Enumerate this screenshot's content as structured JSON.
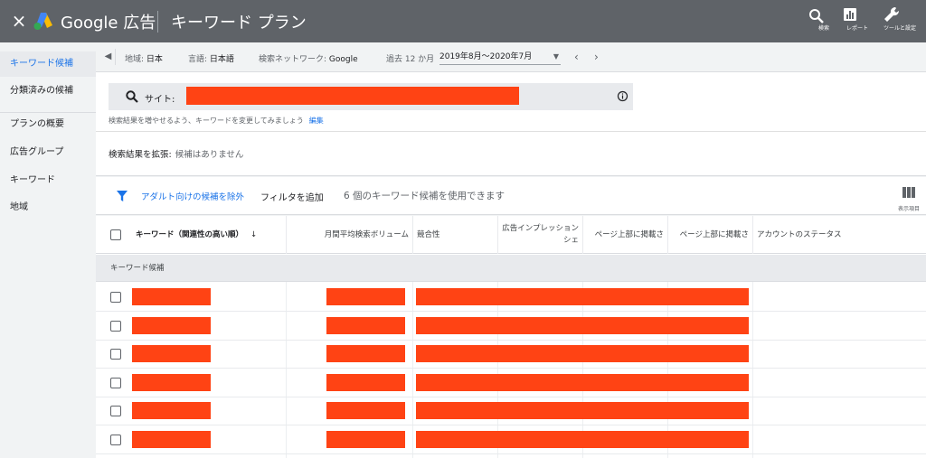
{
  "header": {
    "close_label": "×",
    "brand": "Google 広告",
    "title": "キーワード プラン",
    "tools": [
      {
        "icon": "search-icon",
        "label": "検索"
      },
      {
        "icon": "report-icon",
        "label": "レポート"
      },
      {
        "icon": "wrench-icon",
        "label": "ツールと設定"
      }
    ]
  },
  "sidebar": {
    "items": [
      {
        "label": "キーワード候補",
        "active": true
      },
      {
        "label": "分類済みの候補",
        "active": false
      },
      {
        "label": "プランの概要",
        "active": false
      },
      {
        "label": "広告グループ",
        "active": false
      },
      {
        "label": "キーワード",
        "active": false
      },
      {
        "label": "地域",
        "active": false
      }
    ]
  },
  "filterbar": {
    "location_label": "地域:",
    "location_value": "日本",
    "language_label": "言語:",
    "language_value": "日本語",
    "network_label": "検索ネットワーク:",
    "network_value": "Google",
    "period_label": "過去 12 か月",
    "date_range": "2019年8月〜2020年7月"
  },
  "search": {
    "prefix": "サイト:",
    "hint": "検索結果を増やせるよう、キーワードを変更してみましょう",
    "edit_link": "編集",
    "expand_label": "検索結果を拡張:",
    "expand_value": "候補はありません"
  },
  "toolbar": {
    "exclude_adult": "アダルト向けの候補を除外",
    "add_filter": "フィルタを追加",
    "count_text": "6 個のキーワード候補を使用できます",
    "columns_label": "表示項目"
  },
  "table": {
    "columns": [
      "キーワード（関連性の高い順）",
      "月間平均検索ボリューム",
      "競合性",
      "広告インプレッション シェ",
      "ページ上部に掲載さ",
      "ページ上部に掲載さ",
      "アカウントのステータス"
    ],
    "group_label": "キーワード候補",
    "row_count": 6
  },
  "colors": {
    "header_bg": "#5f6368",
    "accent": "#1a73e8",
    "redaction": "#ff4314"
  }
}
